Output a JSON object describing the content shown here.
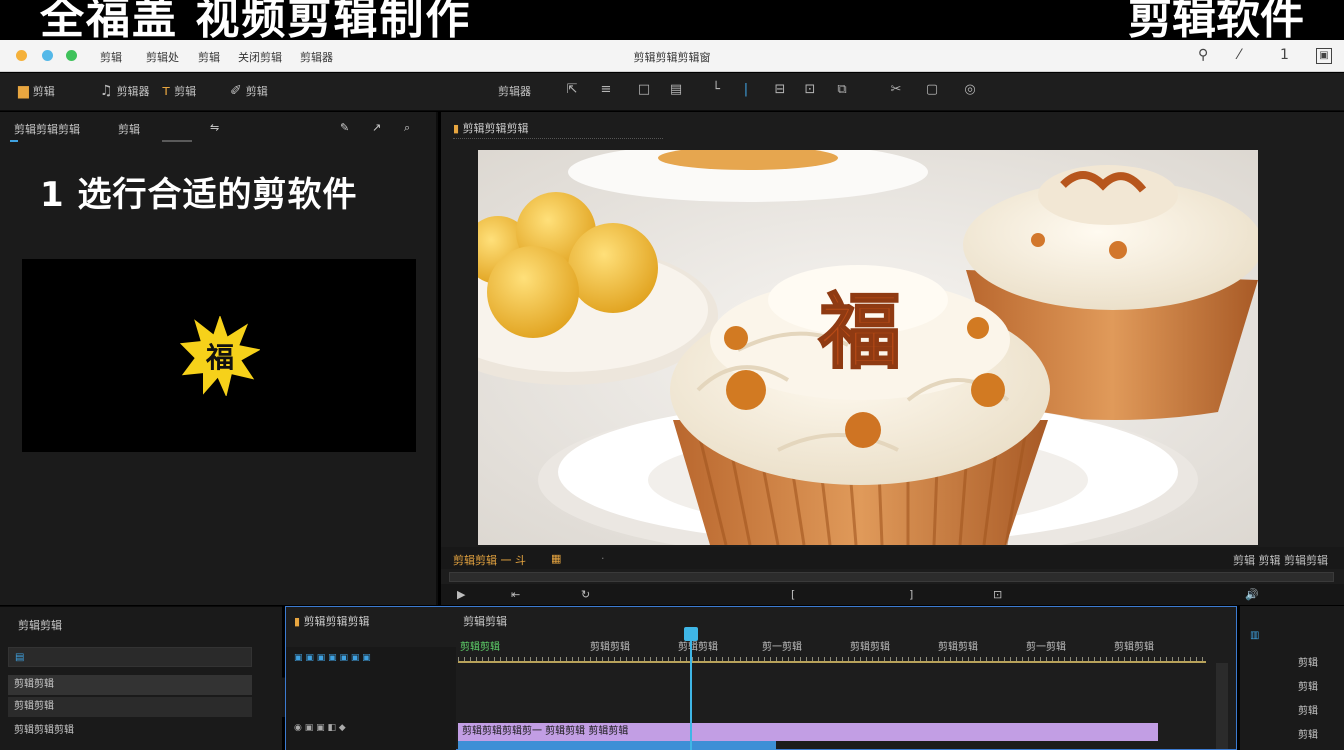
{
  "banner": {
    "left_text": "全福盖 视频剪辑制作",
    "right_text": "剪辑软件"
  },
  "titlebar": {
    "menus": [
      "剪辑",
      "剪辑处",
      "剪辑",
      "关闭剪辑",
      "剪辑器"
    ],
    "center_title": "剪辑剪辑剪辑窗",
    "page_number": "1",
    "colors": {
      "red": "#f5b13a",
      "yellow": "#54b8e8",
      "green": "#3fc25b"
    }
  },
  "toolbar": {
    "items": [
      "剪辑",
      "剪辑器",
      "剪辑",
      "剪辑"
    ],
    "center_label": "剪辑器"
  },
  "left_panel": {
    "header_items": [
      "剪辑剪辑剪辑",
      "剪辑"
    ],
    "overlay_title": "1 选行合适的剪软件",
    "badge_char": "福"
  },
  "viewer": {
    "header": "剪辑剪辑剪辑",
    "bar_left": "剪辑剪辑 一 斗",
    "bar_right": "剪辑 剪辑 剪辑剪辑"
  },
  "bottom_left": {
    "header": "剪辑剪辑",
    "rows": [
      "剪辑剪辑",
      "剪辑剪辑",
      "剪辑剪辑剪辑"
    ]
  },
  "timeline": {
    "header": "剪辑剪辑剪辑",
    "tab": "剪辑剪辑",
    "ruler_labels": [
      "剪辑剪辑",
      "剪辑剪辑",
      "剪辑剪辑",
      "剪一剪辑",
      "剪辑剪辑",
      "剪辑剪辑",
      "剪一剪辑",
      "剪辑剪辑"
    ],
    "clip_label": "剪辑剪辑剪辑剪一   剪辑剪辑        剪辑剪辑"
  },
  "right_panel": {
    "rows": [
      "剪辑",
      "剪辑",
      "剪辑",
      "剪辑"
    ]
  }
}
